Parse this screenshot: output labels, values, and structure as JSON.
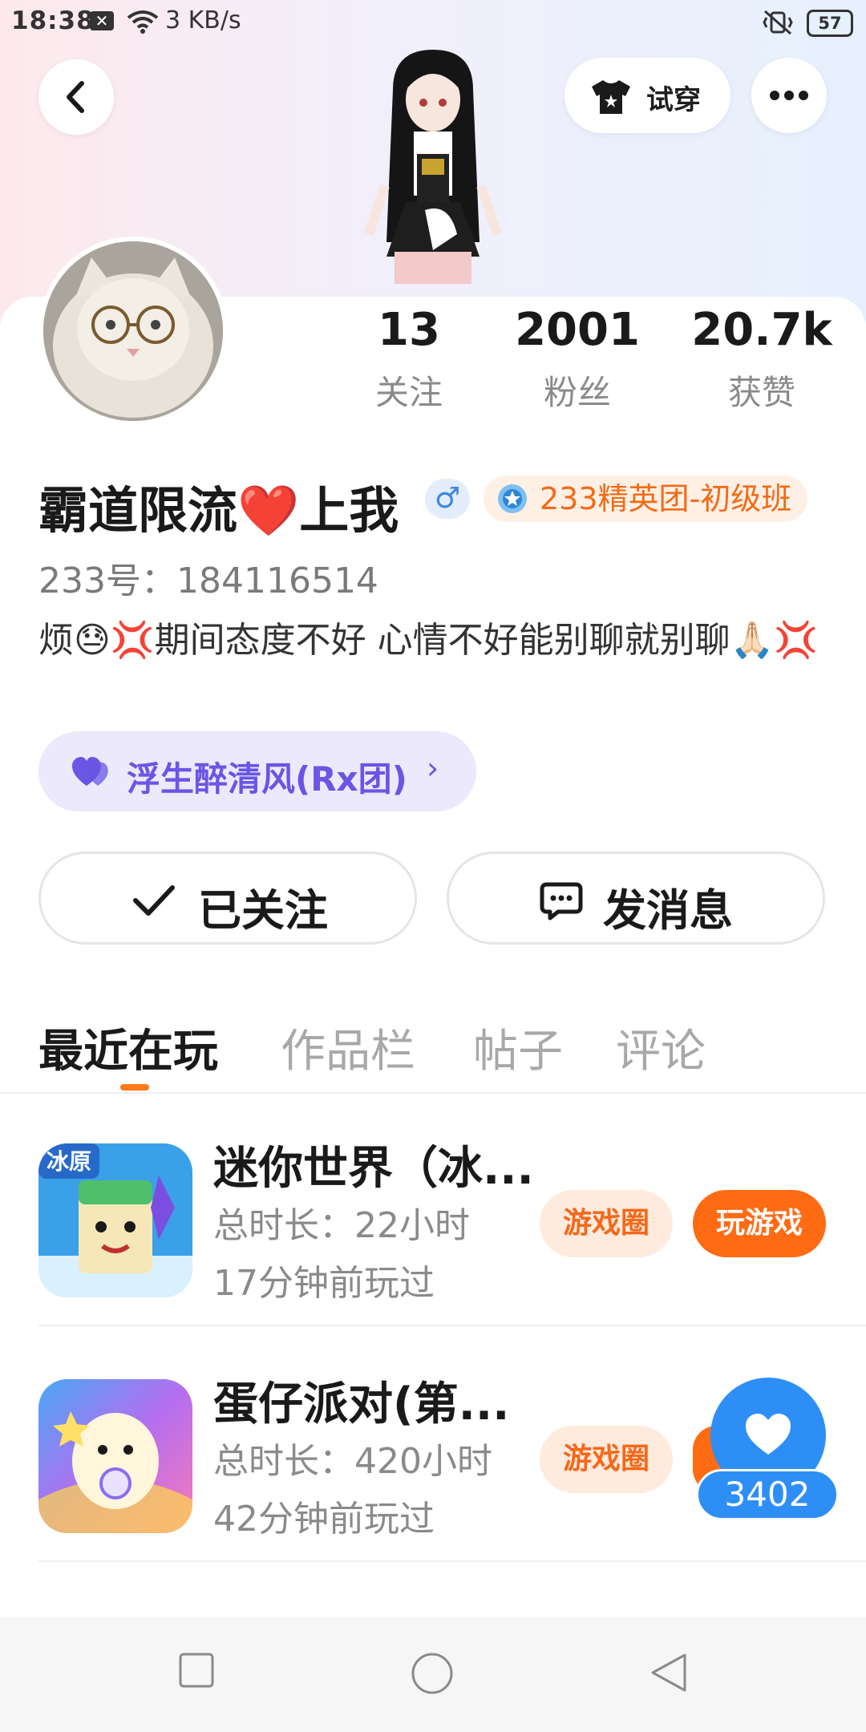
{
  "status_bar": {
    "time": "18:38",
    "speed": "3 KB/s",
    "battery": "57"
  },
  "header": {
    "tryon_label": "试穿"
  },
  "profile": {
    "stats": [
      {
        "value": "13",
        "label": "关注"
      },
      {
        "value": "2001",
        "label": "粉丝"
      },
      {
        "value": "20.7k",
        "label": "获赞"
      }
    ],
    "nickname": "霸道限流❤️上我",
    "gender_symbol": "♂",
    "rank_badge": "233精英团-初级班",
    "uid": "233号：184116514",
    "bio": "烦😓💢期间态度不好 心情不好能别聊就别聊🙏🏻💢",
    "group_name": "浮生醉清风(Rx团)",
    "group_chevron": "›",
    "follow_label": "已关注",
    "message_label": "发消息"
  },
  "tabs": [
    {
      "label": "最近在玩",
      "active": true
    },
    {
      "label": "作品栏",
      "active": false
    },
    {
      "label": "帖子",
      "active": false
    },
    {
      "label": "评论",
      "active": false
    }
  ],
  "games": [
    {
      "title": "迷你世界（冰...",
      "duration": "总时长：22小时",
      "last_played": "17分钟前玩过",
      "icon_badge": "冰原",
      "circle_label": "游戏圈",
      "play_label": "玩游戏"
    },
    {
      "title": "蛋仔派对(第...",
      "duration": "总时长：420小时",
      "last_played": "42分钟前玩过",
      "circle_label": "游戏圈"
    }
  ],
  "float_like": {
    "count": "3402"
  },
  "colors": {
    "accent_orange": "#ff6b13",
    "group_purple": "#6a55e4",
    "like_blue": "#2d8ff6"
  }
}
